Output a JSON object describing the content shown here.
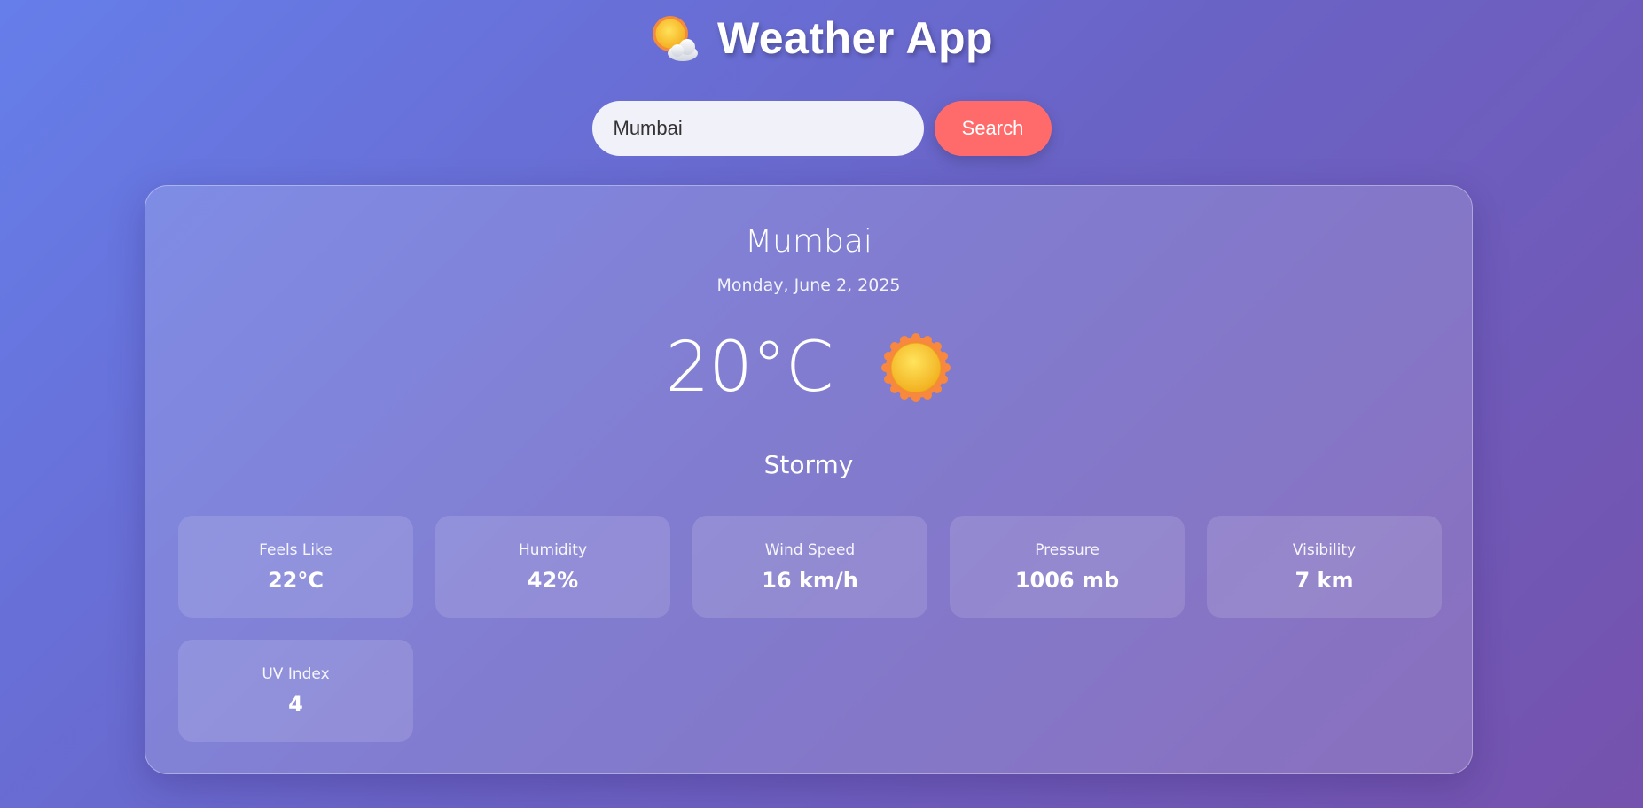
{
  "app": {
    "title": "Weather App",
    "logo_icon": "sun-behind-cloud-icon"
  },
  "search": {
    "value": "Mumbai",
    "button_label": "Search"
  },
  "current": {
    "city": "Mumbai",
    "date": "Monday, June 2, 2025",
    "temperature": "20°C",
    "condition": "Stormy",
    "condition_icon": "sun-icon"
  },
  "stats": [
    {
      "label": "Feels Like",
      "value": "22°C"
    },
    {
      "label": "Humidity",
      "value": "42%"
    },
    {
      "label": "Wind Speed",
      "value": "16 km/h"
    },
    {
      "label": "Pressure",
      "value": "1006 mb"
    },
    {
      "label": "Visibility",
      "value": "7 km"
    },
    {
      "label": "UV Index",
      "value": "4"
    }
  ],
  "colors": {
    "background_start": "#667eea",
    "background_end": "#7552ad",
    "search_button": "#ff6b6b",
    "sun": "#fbc531",
    "sun_rays": "#f7883d"
  }
}
